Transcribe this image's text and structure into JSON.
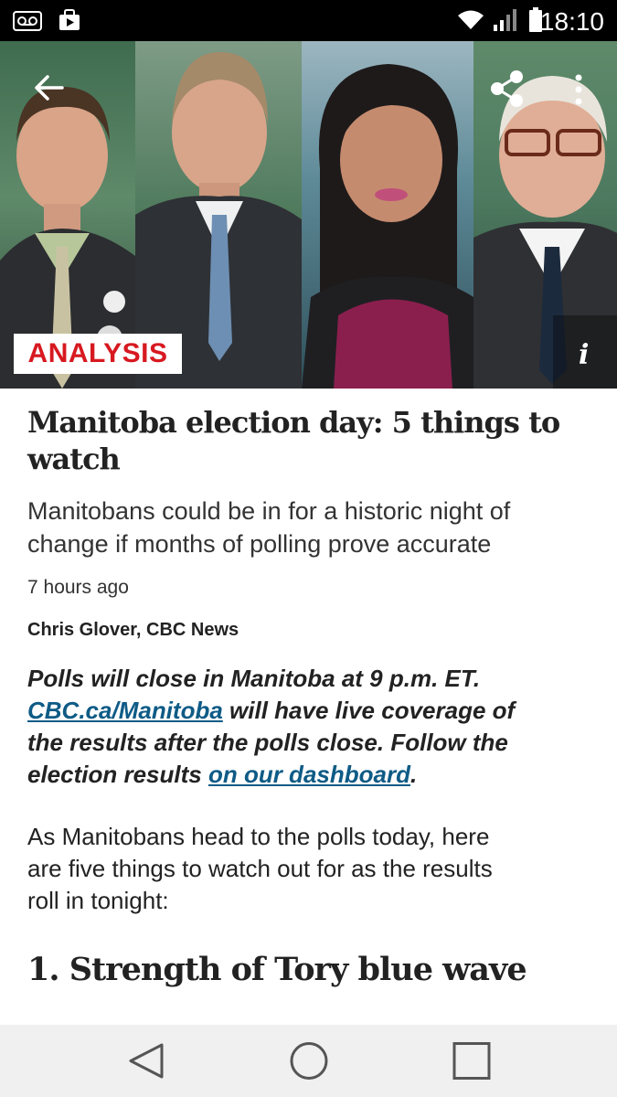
{
  "status_bar": {
    "time": "18:10"
  },
  "hero": {
    "badge": "ANALYSIS",
    "info_label": "i"
  },
  "article": {
    "headline_line1": "Manitoba election day: 5 things to",
    "headline_line2": "watch",
    "deck_line1": "Manitobans could be in for a historic night of",
    "deck_line2": "change if months of polling prove accurate",
    "time_ago": "7 hours ago",
    "byline": "Chris Glover, CBC News",
    "lead": {
      "line1": "Polls will close in Manitoba at 9 p.m. ET.",
      "link1": "CBC.ca/Manitoba",
      "line2_rest": " will have live coverage of",
      "line3": "the results after the polls close. Follow the",
      "line4_pre": "election results ",
      "link2": "on our dashboard",
      "line4_post": "."
    },
    "body_line1": "As Manitobans head to the polls today, here",
    "body_line2": "are five things to watch out for as the results",
    "body_line3": "roll in tonight:",
    "subhead": "1. Strength of Tory blue wave"
  },
  "colors": {
    "badge_text": "#d71920",
    "link": "#0e5b86",
    "status_bar": "#000000",
    "nav_bar": "#f0f0f0"
  }
}
